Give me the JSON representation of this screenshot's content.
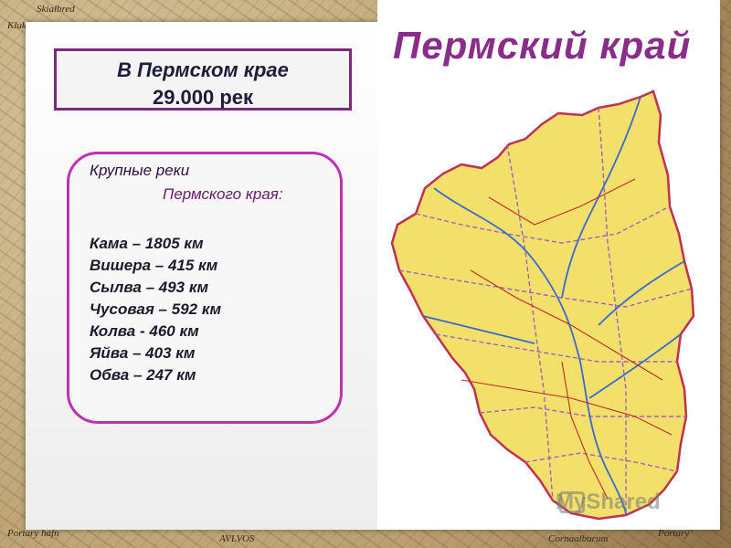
{
  "frame": {
    "labels": [
      "Skialbred",
      "Kluka",
      "Portary hafn",
      "AVLVOS",
      "Cornaalburum",
      "Portary"
    ]
  },
  "info_box": {
    "line1": "В Пермском крае",
    "line2": "29.000 рек"
  },
  "rivers": {
    "heading1": "Крупные реки",
    "heading2": "Пермского края:",
    "items": [
      "Кама – 1805 км",
      "Вишера – 415 км",
      "Сылва – 493 км",
      "Чусовая – 592 км",
      "Колва -  460 км",
      "Яйва – 403 км",
      "Обва – 247 км"
    ]
  },
  "map": {
    "title": "Пермский край",
    "colors": {
      "region_fill": "#f2e06a",
      "region_border": "#c03050",
      "rivers": "#3a6ad0",
      "roads": "#c02828",
      "districts": "#a060c0"
    }
  },
  "watermark": {
    "text": "MyShared"
  }
}
